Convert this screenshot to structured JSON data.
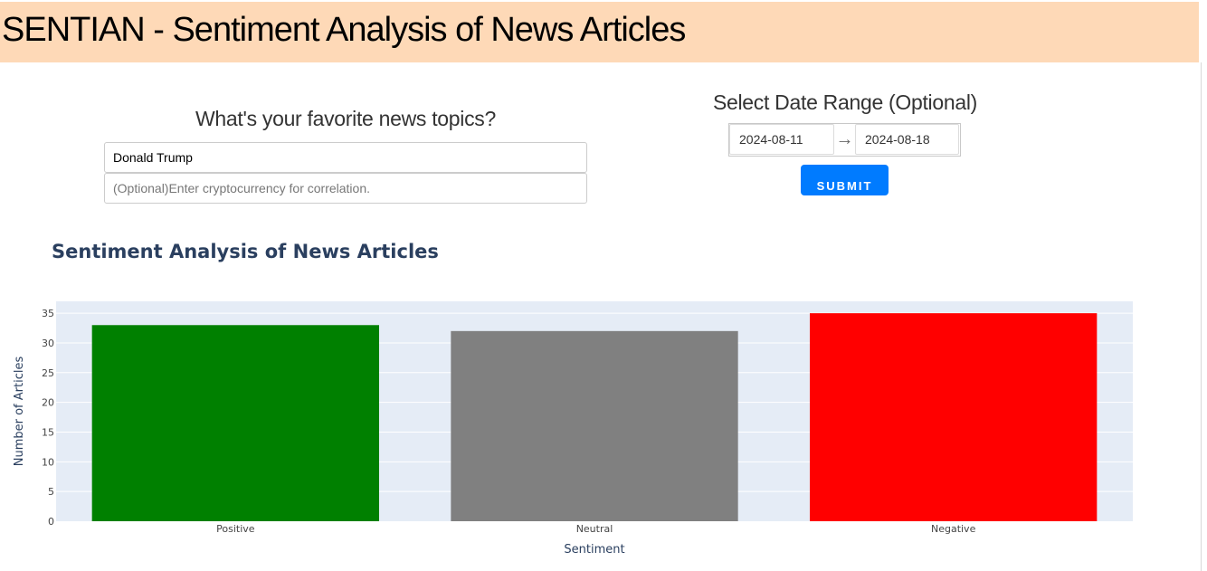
{
  "header": {
    "title": "SENTIAN - Sentiment Analysis of News Articles"
  },
  "topics": {
    "heading": "What's your favorite news topics?",
    "topic_value": "Donald Trump",
    "crypto_placeholder": "(Optional)Enter cryptocurrency for correlation."
  },
  "date_range": {
    "heading": "Select Date Range (Optional)",
    "start": "2024-08-11",
    "arrow": "→",
    "end": "2024-08-18"
  },
  "submit_label": "SUBMIT",
  "colors": {
    "header_bg": "#fed9b7",
    "button": "#007bff",
    "plot_bg": "#e5ecf6"
  },
  "chart_data": {
    "type": "bar",
    "title": "Sentiment Analysis of News Articles",
    "xlabel": "Sentiment",
    "ylabel": "Number of Articles",
    "categories": [
      "Positive",
      "Neutral",
      "Negative"
    ],
    "values": [
      33,
      32,
      35
    ],
    "colors": [
      "#008000",
      "#808080",
      "#ff0000"
    ],
    "ylim": [
      0,
      37
    ],
    "yticks": [
      0,
      5,
      10,
      15,
      20,
      25,
      30,
      35
    ],
    "grid": true
  }
}
